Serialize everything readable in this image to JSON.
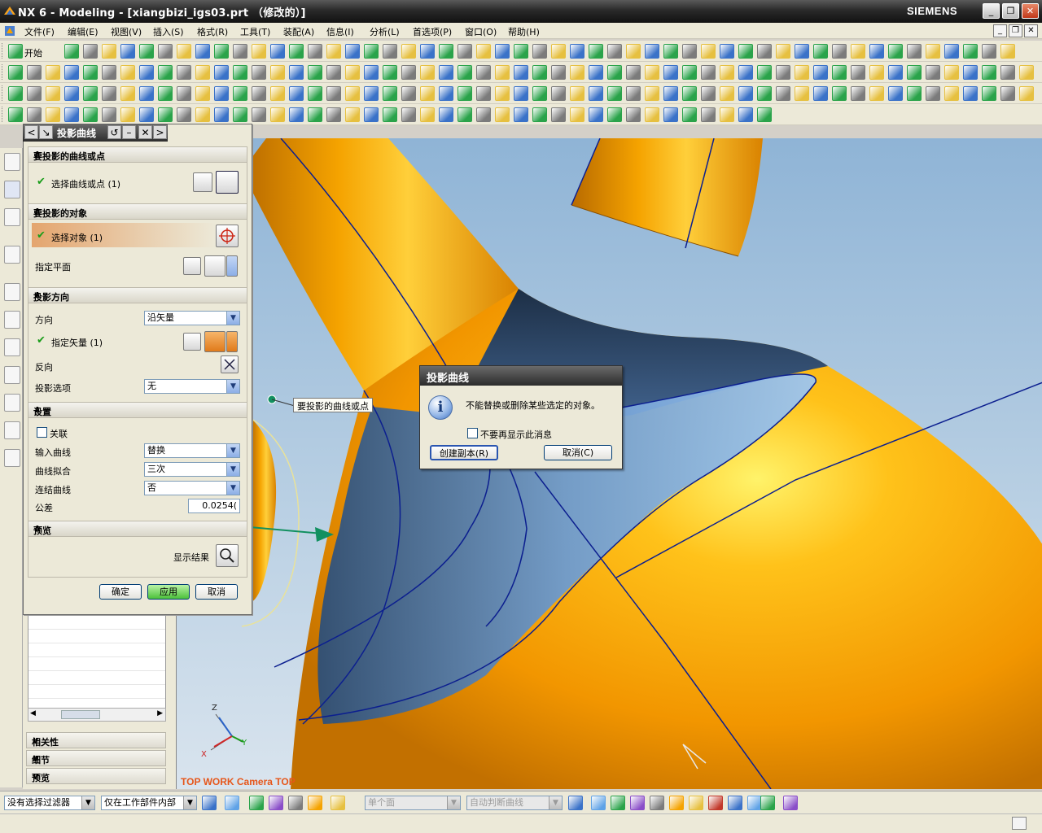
{
  "window": {
    "title": "NX 6 - Modeling - [xiangbizi_igs03.prt （修改的）]",
    "brand": "SIEMENS",
    "controls": [
      "_",
      "❐",
      "✕"
    ]
  },
  "menu": {
    "items": [
      "文件(F)",
      "编辑(E)",
      "视图(V)",
      "插入(S)",
      "格式(R)",
      "工具(T)",
      "装配(A)",
      "信息(I)",
      "分析(L)",
      "首选项(P)",
      "窗口(O)",
      "帮助(H)"
    ]
  },
  "toolbar": {
    "start_label": "开始"
  },
  "dialog": {
    "title": "投影曲线",
    "sections": {
      "curves": {
        "header": "要投影的曲线或点",
        "select_label": "选择曲线或点 (1)"
      },
      "target": {
        "header": "要投影的对象",
        "select_label": "选择对象 (1)",
        "plane_label": "指定平面"
      },
      "direction": {
        "header": "投影方向",
        "direction_label": "方向",
        "direction_value": "沿矢量",
        "vector_label": "指定矢量 (1)",
        "reverse_label": "反向",
        "option_label": "投影选项",
        "option_value": "无"
      },
      "settings": {
        "header": "设置",
        "associative_label": "关联",
        "input_label": "输入曲线",
        "input_value": "替换",
        "fit_label": "曲线拟合",
        "fit_value": "三次",
        "join_label": "连结曲线",
        "join_value": "否",
        "tolerance_label": "公差",
        "tolerance_value": "0.0254("
      },
      "preview": {
        "header": "预览",
        "show_label": "显示结果"
      }
    },
    "buttons": {
      "ok": "确定",
      "apply": "应用",
      "cancel": "取消"
    }
  },
  "navigator": {
    "sections": [
      "相关性",
      "细节",
      "预览"
    ]
  },
  "messagebox": {
    "title": "投影曲线",
    "message": "不能替换或删除某些选定的对象。",
    "checkbox_label": "不要再显示此消息",
    "create_copy": "创建副本(R)",
    "cancel": "取消(C)"
  },
  "viewport": {
    "callout": "要投影的曲线或点",
    "view_label": "TOP WORK Camera TOP",
    "triad": {
      "z": "Z",
      "x": "X",
      "y": "Y"
    }
  },
  "statusbar": {
    "filter": "没有选择过滤器",
    "scope": "仅在工作部件内部",
    "face_rule": "单个面",
    "curve_rule": "自动判断曲线"
  },
  "colors": {
    "orange_body": "#f5a300",
    "blue_surface": "#6d9bd0",
    "highlight_orange": "#e4a56e",
    "check_green": "#1a9d1a"
  }
}
